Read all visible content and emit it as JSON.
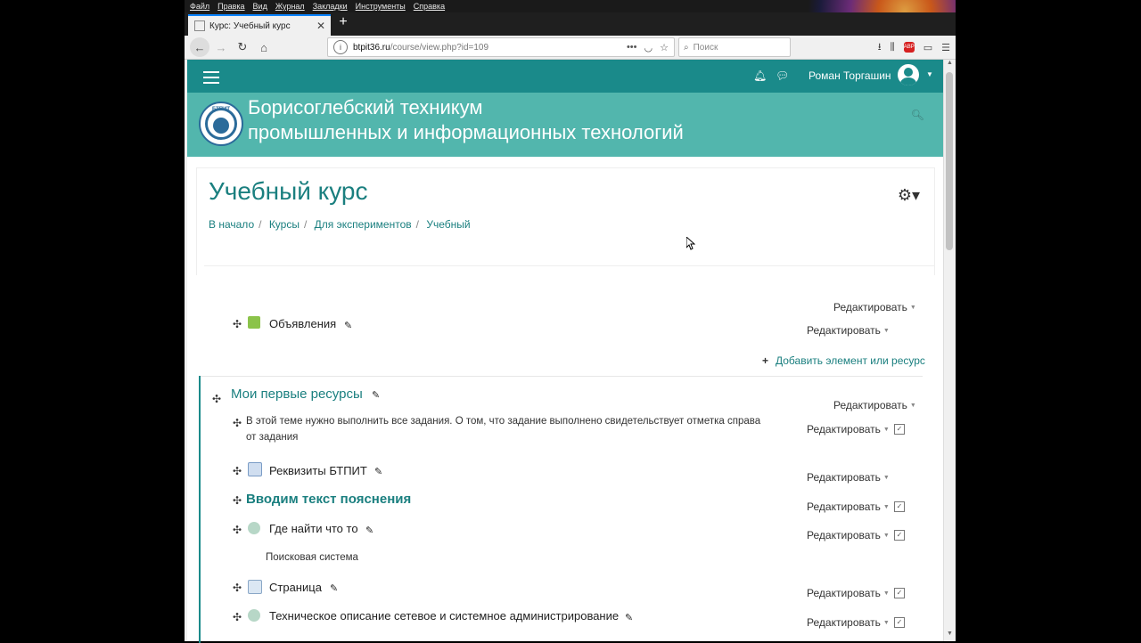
{
  "menu": [
    "Файл",
    "Правка",
    "Вид",
    "Журнал",
    "Закладки",
    "Инструменты",
    "Справка"
  ],
  "tab": {
    "title": "Курс: Учебный курс",
    "new": "+"
  },
  "url": {
    "host": "btpit36.ru",
    "path": "/course/view.php?id=109"
  },
  "search": {
    "placeholder": "Поиск"
  },
  "nav": {
    "user": "Роман Торгашин"
  },
  "site": {
    "title1": "Борисоглебский техникум",
    "title2": "промышленных и информационных технологий",
    "logo_abbr": "БТПИТ"
  },
  "page": {
    "title": "Учебный курс"
  },
  "breadcrumb": [
    "В начало",
    "Курсы",
    "Для экспериментов",
    "Учебный"
  ],
  "labels": {
    "edit": "Редактировать",
    "add": "Добавить элемент или ресурс"
  },
  "section0": {
    "item": "Объявления"
  },
  "section1": {
    "title": "Мои первые ресурсы",
    "intro_line1": "В этой теме нужно выполнить все задания. О том, что задание выполнено свидетельствует отметка справа",
    "intro_line2": "от задания",
    "items": [
      "Реквизиты БТПИТ",
      "Вводим текст пояснения",
      "Где найти что то",
      "Поисковая система",
      "Страница",
      "Техническое описание сетевое и системное администрирование"
    ]
  },
  "colors": {
    "teal": "#1a8a8a",
    "banner": "#52b6ad",
    "link": "#1a7f7f"
  }
}
